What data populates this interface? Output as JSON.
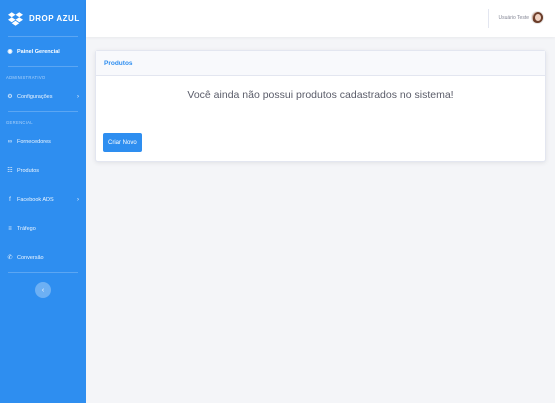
{
  "brand": {
    "name": "DROP AZUL"
  },
  "sidebar": {
    "dashboard_label": "Painel Gerencial",
    "sections": {
      "admin": "ADMINISTRATIVO",
      "manager": "GERENCIAL"
    },
    "items": [
      {
        "label": "Configurações",
        "icon": "gear-icon",
        "has_children": true
      },
      {
        "label": "Fornecedores",
        "icon": "link-icon",
        "has_children": false
      },
      {
        "label": "Produtos",
        "icon": "cart-icon",
        "has_children": false
      },
      {
        "label": "Facebook ADS",
        "icon": "facebook-icon",
        "has_children": true
      },
      {
        "label": "Tráfego",
        "icon": "chart-icon",
        "has_children": false
      },
      {
        "label": "Conversão",
        "icon": "phone-icon",
        "has_children": false
      }
    ],
    "toggle_icon": "chevron-left-icon"
  },
  "topbar": {
    "user_name": "Usuário Teste"
  },
  "card": {
    "title": "Produtos",
    "empty_message": "Você ainda não possui produtos cadastrados no sistema!",
    "create_button": "Criar Novo"
  },
  "colors": {
    "primary": "#2e8ef0",
    "background": "#f4f5f8"
  }
}
